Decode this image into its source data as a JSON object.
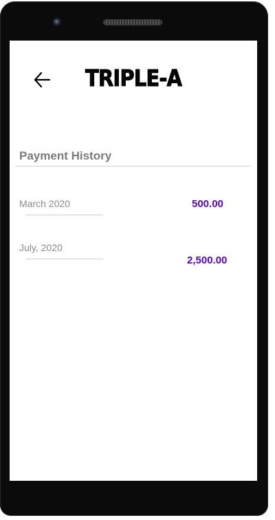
{
  "header": {
    "back_icon": "arrow-left-icon",
    "app_title": "TRIPLE-A"
  },
  "payment_history": {
    "title": "Payment History",
    "entries": [
      {
        "date": "March 2020",
        "amount": "500.00"
      },
      {
        "date": "July, 2020",
        "amount": "2,500.00"
      }
    ]
  },
  "colors": {
    "amount": "#5200d6",
    "section_title": "#7a7a7a",
    "date_text": "#8a8a8a",
    "device_frame": "#0b0b0b"
  }
}
